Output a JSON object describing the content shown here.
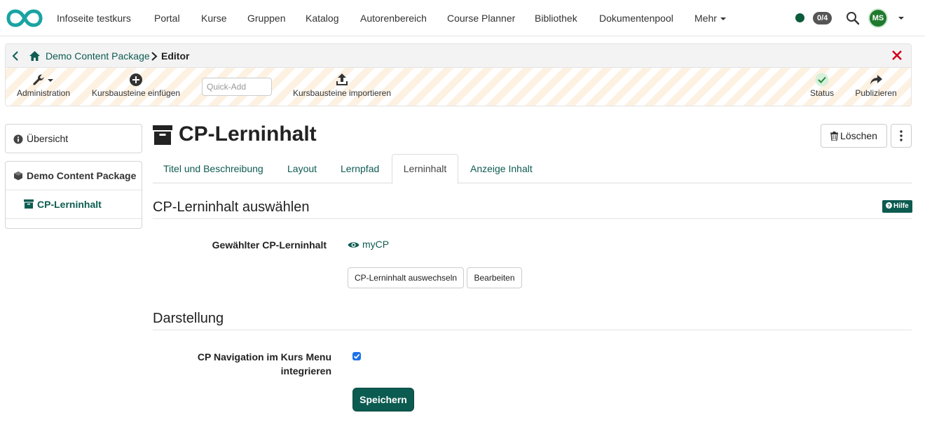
{
  "topnav": {
    "items": [
      "Infoseite testkurs",
      "Portal",
      "Kurse",
      "Gruppen",
      "Katalog",
      "Autorenbereich",
      "Course Planner",
      "Bibliothek",
      "Dokumentenpool",
      "Mehr"
    ],
    "badge": "0/4",
    "avatar_initials": "MS"
  },
  "breadcrumb": {
    "link": "Demo Content Package",
    "current": "Editor"
  },
  "toolbar": {
    "administration": "Administration",
    "insert": "Kursbausteine einfügen",
    "quick_add_placeholder": "Quick-Add",
    "import": "Kursbausteine importieren",
    "status": "Status",
    "publish": "Publizieren"
  },
  "sidebar": {
    "overview": "Übersicht",
    "course": "Demo Content Package",
    "node": "CP-Lerninhalt"
  },
  "page": {
    "title": "CP-Lerninhalt",
    "delete_label": "Löschen"
  },
  "tabs": [
    "Titel und Beschreibung",
    "Layout",
    "Lernpfad",
    "Lerninhalt",
    "Anzeige Inhalt"
  ],
  "active_tab": "Lerninhalt",
  "select_section": {
    "title": "CP-Lerninhalt auswählen",
    "help": "Hilfe",
    "field_label": "Gewählter CP-Lerninhalt",
    "field_value": "myCP",
    "replace_button": "CP-Lerninhalt auswechseln",
    "edit_button": "Bearbeiten"
  },
  "display_section": {
    "title": "Darstellung",
    "checkbox_label_line1": "CP Navigation im Kurs Menu",
    "checkbox_label_line2": "integrieren",
    "checkbox_checked": true,
    "save_button": "Speichern"
  },
  "colors": {
    "brand": "#0c5b50",
    "link": "#0e5c52",
    "close": "#d0021b",
    "stripe": "#fdf1e2"
  }
}
